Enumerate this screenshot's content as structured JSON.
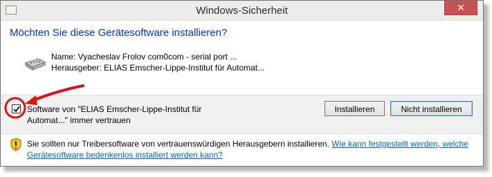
{
  "window": {
    "title": "Windows-Sicherheit",
    "close_glyph": "✕"
  },
  "heading": "Möchten Sie diese Gerätesoftware installieren?",
  "driver": {
    "name": "Name: Vyacheslav Frolov com0com - serial port ...",
    "publisher": "Herausgeber: ELIAS Emscher-Lippe-Institut für Automat..."
  },
  "trust_checkbox": {
    "checked": true,
    "label": "Software von \"ELIAS Emscher-Lippe-Institut für Automat...\" immer vertrauen"
  },
  "buttons": {
    "install": "Installieren",
    "dont_install": "Nicht installieren"
  },
  "footer": {
    "text": "Sie sollten nur Treibersoftware von vertrauenswürdigen Herausgebern installieren.",
    "link": "Wie kann festgestellt werden, welche Gerätesoftware bedenkenlos installiert werden kann?"
  },
  "colors": {
    "heading": "#0033cc",
    "link": "#0066cc",
    "annotation": "#e01010"
  },
  "icons": {
    "app": "window-icon",
    "device": "serial-connector-icon",
    "warning": "shield-warning-icon",
    "close": "close-icon"
  }
}
